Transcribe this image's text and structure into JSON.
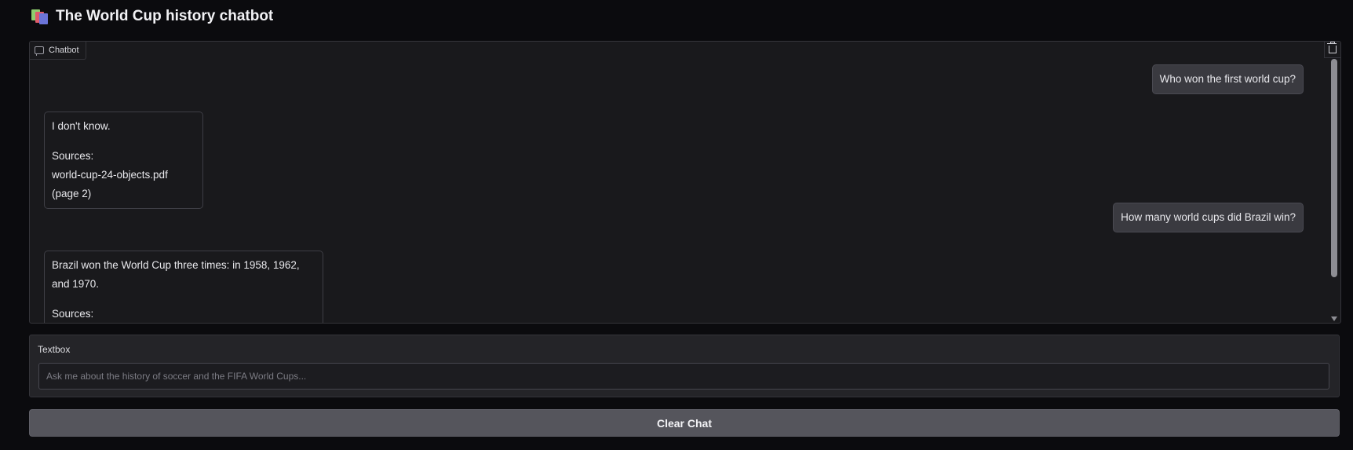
{
  "header": {
    "title": "The World Cup history chatbot",
    "logo_icon": "stacked-books-icon"
  },
  "chatbot": {
    "label": "Chatbot",
    "messages": [
      {
        "role": "user",
        "text": "Who won the first world cup?"
      },
      {
        "role": "bot",
        "lines": [
          "I don't know.",
          "Sources:",
          "world-cup-24-objects.pdf (page 2)"
        ]
      },
      {
        "role": "user",
        "text": "How many world cups did Brazil win?"
      },
      {
        "role": "bot",
        "lines": [
          "Brazil won the World Cup three times: in 1958, 1962, and 1970.",
          "Sources:"
        ]
      }
    ]
  },
  "textbox": {
    "label": "Textbox",
    "placeholder": "Ask me about the history of soccer and the FIFA World Cups..."
  },
  "clear_button": {
    "label": "Clear Chat"
  },
  "colors": {
    "background": "#0b0b0e",
    "panel": "#19191c",
    "user_bubble": "#3a3a40",
    "button": "#55555c"
  }
}
